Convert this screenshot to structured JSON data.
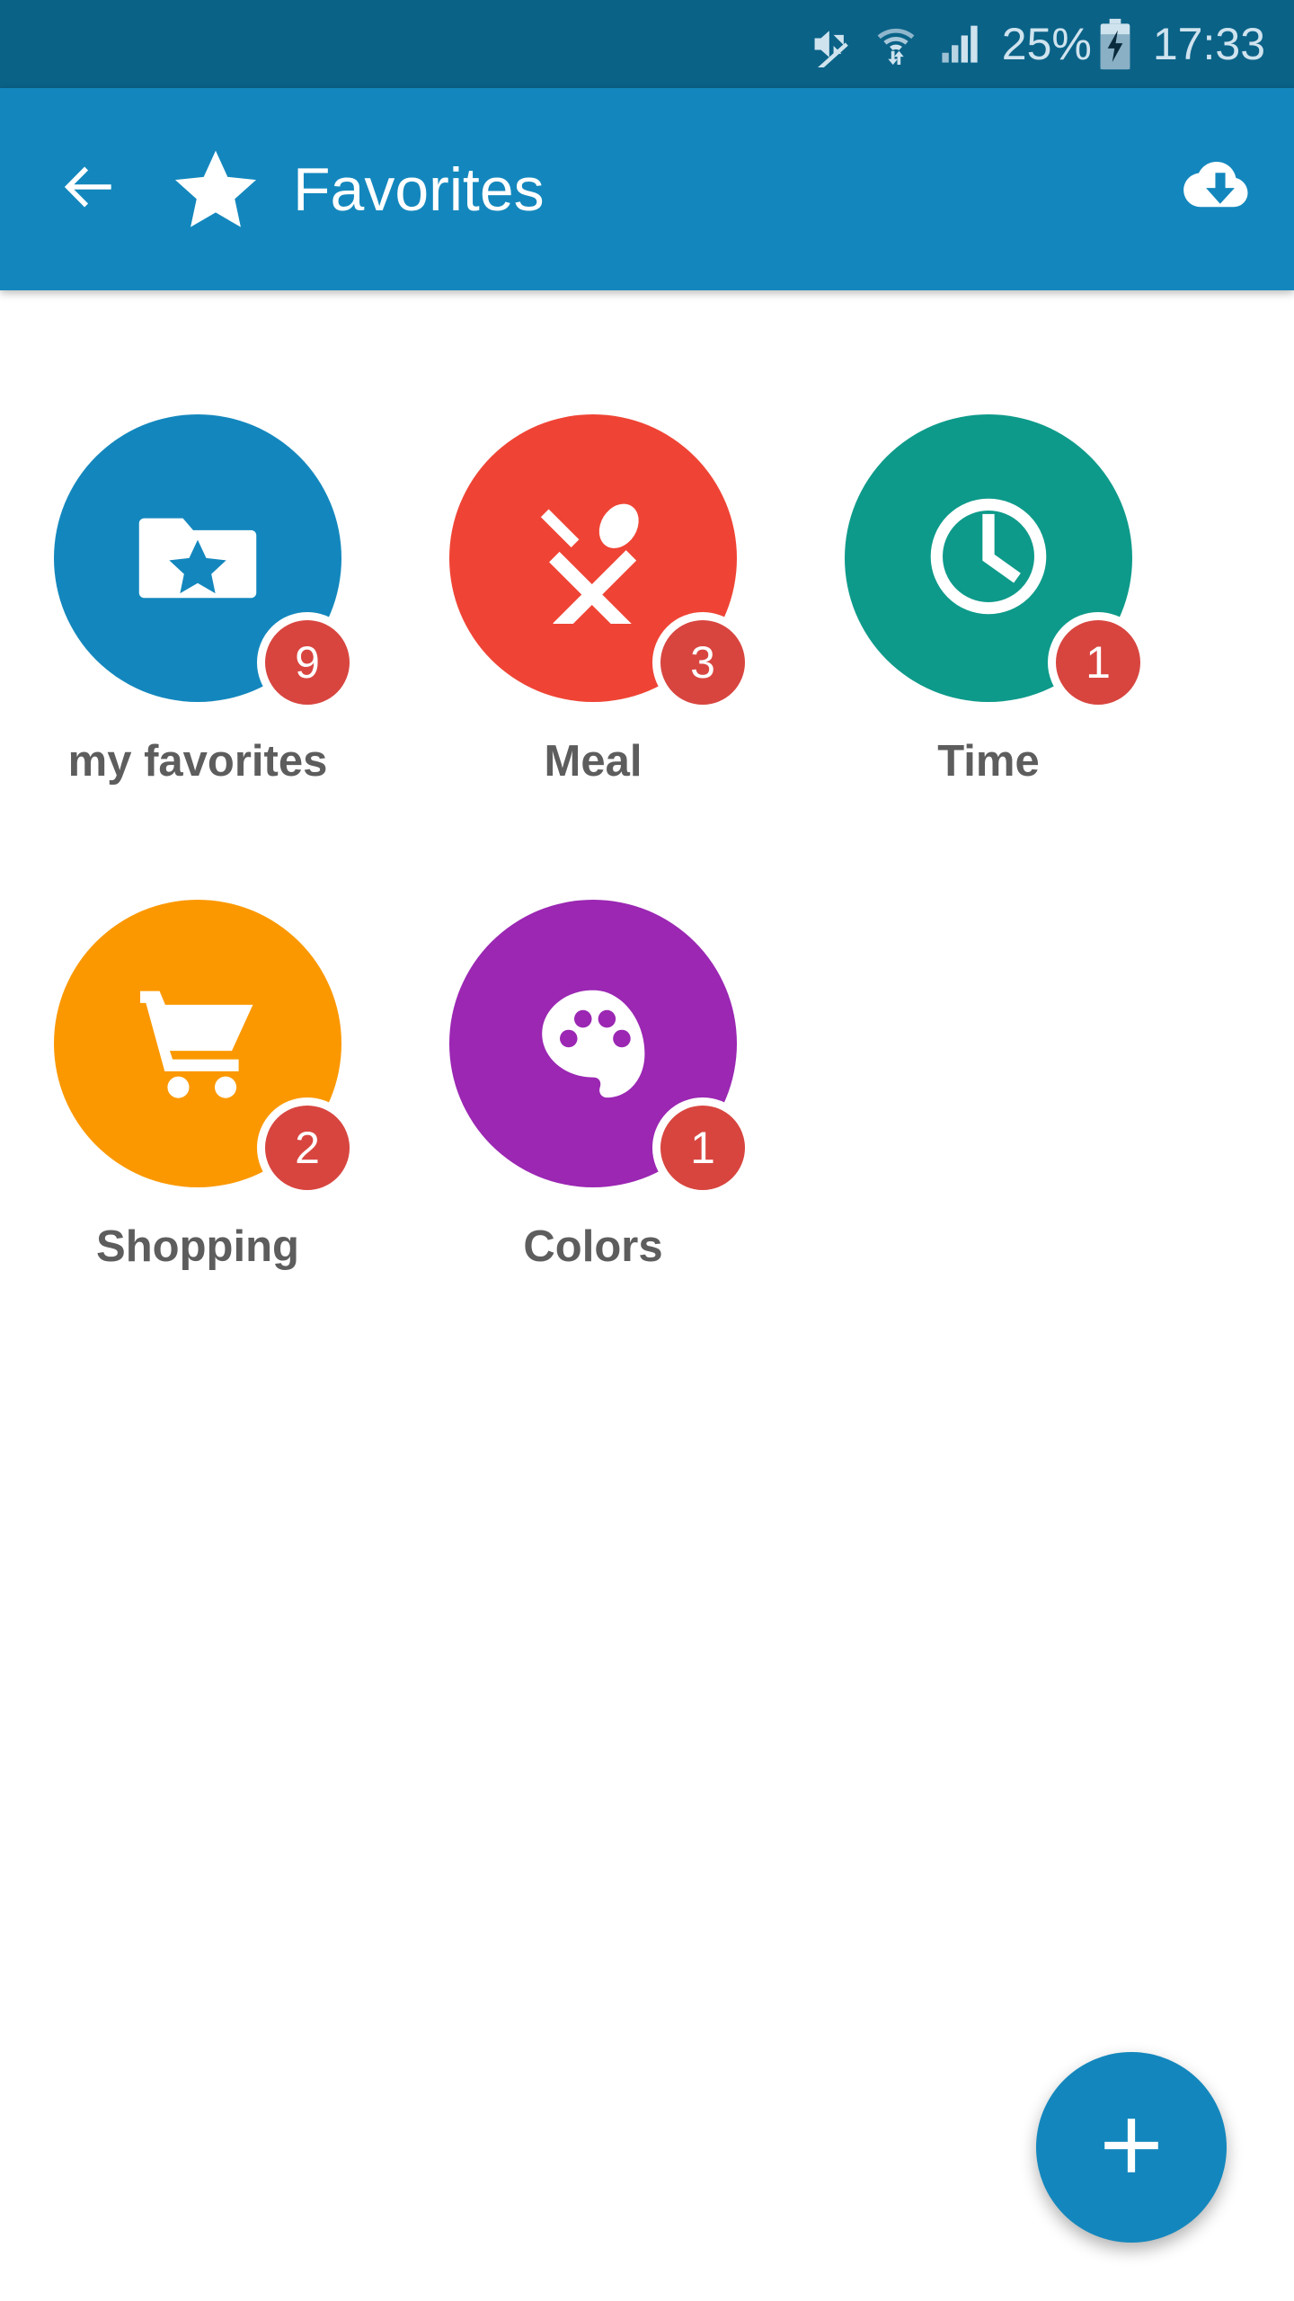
{
  "status_bar": {
    "background": "#0a6287",
    "foreground": "#cfe3ee",
    "mute_icon": "mute-icon",
    "wifi_icon": "wifi-transfer-icon",
    "signal_icon": "cellular-signal-icon",
    "battery_percent": "25%",
    "battery_icon": "battery-charging-icon",
    "time": "17:33"
  },
  "app_bar": {
    "background": "#1387bd",
    "back_icon": "back-arrow-icon",
    "leading_icon": "star-icon",
    "title": "Favorites",
    "action_icon": "cloud-download-icon"
  },
  "grid": {
    "tiles": [
      {
        "id": "my-favorites",
        "label": "my favorites",
        "badge": "9",
        "color": "#1387bd",
        "icon": "folder-star-icon"
      },
      {
        "id": "meal",
        "label": "Meal",
        "badge": "3",
        "color": "#ef4435",
        "icon": "cutlery-icon"
      },
      {
        "id": "time",
        "label": "Time",
        "badge": "1",
        "color": "#0d9a8a",
        "icon": "clock-icon"
      },
      {
        "id": "shopping",
        "label": "Shopping",
        "badge": "2",
        "color": "#fb9800",
        "icon": "shopping-cart-icon"
      },
      {
        "id": "colors",
        "label": "Colors",
        "badge": "1",
        "color": "#9b27b3",
        "icon": "palette-icon"
      }
    ],
    "badge_color": "#d8453f",
    "label_color": "#5d5d5d"
  },
  "fab": {
    "icon": "plus-icon",
    "color": "#1387bd"
  }
}
